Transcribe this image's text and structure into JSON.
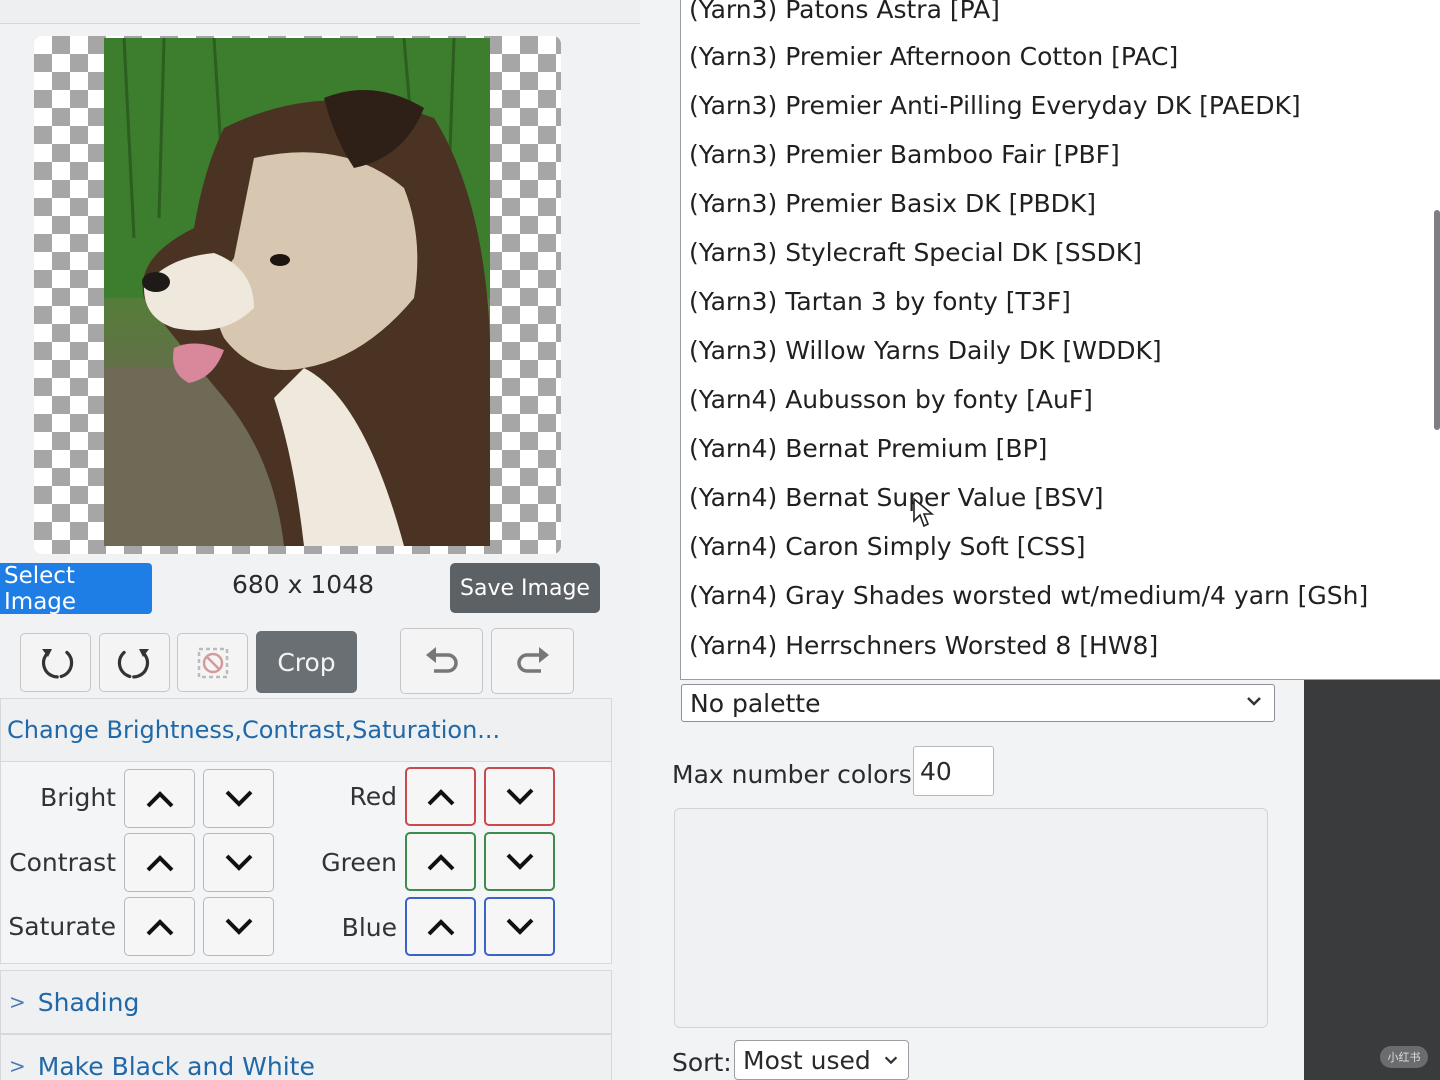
{
  "image_panel": {
    "select_label": "Select Image",
    "dimensions": "680 x 1048",
    "save_label": "Save Image",
    "crop_label": "Crop"
  },
  "toolbar_icons": [
    "rotate-left-icon",
    "rotate-right-icon",
    "reset-icon",
    "undo-icon",
    "redo-icon"
  ],
  "adjust": {
    "header": "Change Brightness,Contrast,Saturation...",
    "rows_left": [
      "Bright",
      "Contrast",
      "Saturate"
    ],
    "rows_right": [
      "Red",
      "Green",
      "Blue"
    ]
  },
  "sections": {
    "shading": "Shading",
    "black_white": "Make Black and White",
    "caret": ">"
  },
  "palette": {
    "selected": "No palette",
    "options": [
      "(Yarn3) Patons Astra [PA]",
      "(Yarn3) Premier Afternoon Cotton [PAC]",
      "(Yarn3) Premier Anti-Pilling Everyday DK [PAEDK]",
      "(Yarn3) Premier Bamboo Fair [PBF]",
      "(Yarn3) Premier Basix DK [PBDK]",
      "(Yarn3) Stylecraft Special DK [SSDK]",
      "(Yarn3) Tartan 3 by fonty [T3F]",
      "(Yarn3) Willow Yarns Daily DK [WDDK]",
      "(Yarn4) Aubusson by fonty [AuF]",
      "(Yarn4) Bernat Premium [BP]",
      "(Yarn4) Bernat Super Value [BSV]",
      "(Yarn4) Caron Simply Soft [CSS]",
      "(Yarn4) Gray Shades worsted wt/medium/4 yarn [GSh]",
      "(Yarn4) Herrschners Worsted 8 [HW8]"
    ]
  },
  "colors": {
    "max_label": "Max number colors:",
    "max_value": "40",
    "sort_label": "Sort:",
    "sort_value": "Most used"
  },
  "watermark": "小红书",
  "theme": {
    "accent": "#1f7ee6",
    "link": "#2168a8",
    "red": "#c84a4a",
    "green": "#3d8c4d",
    "blue": "#3b63c6"
  }
}
